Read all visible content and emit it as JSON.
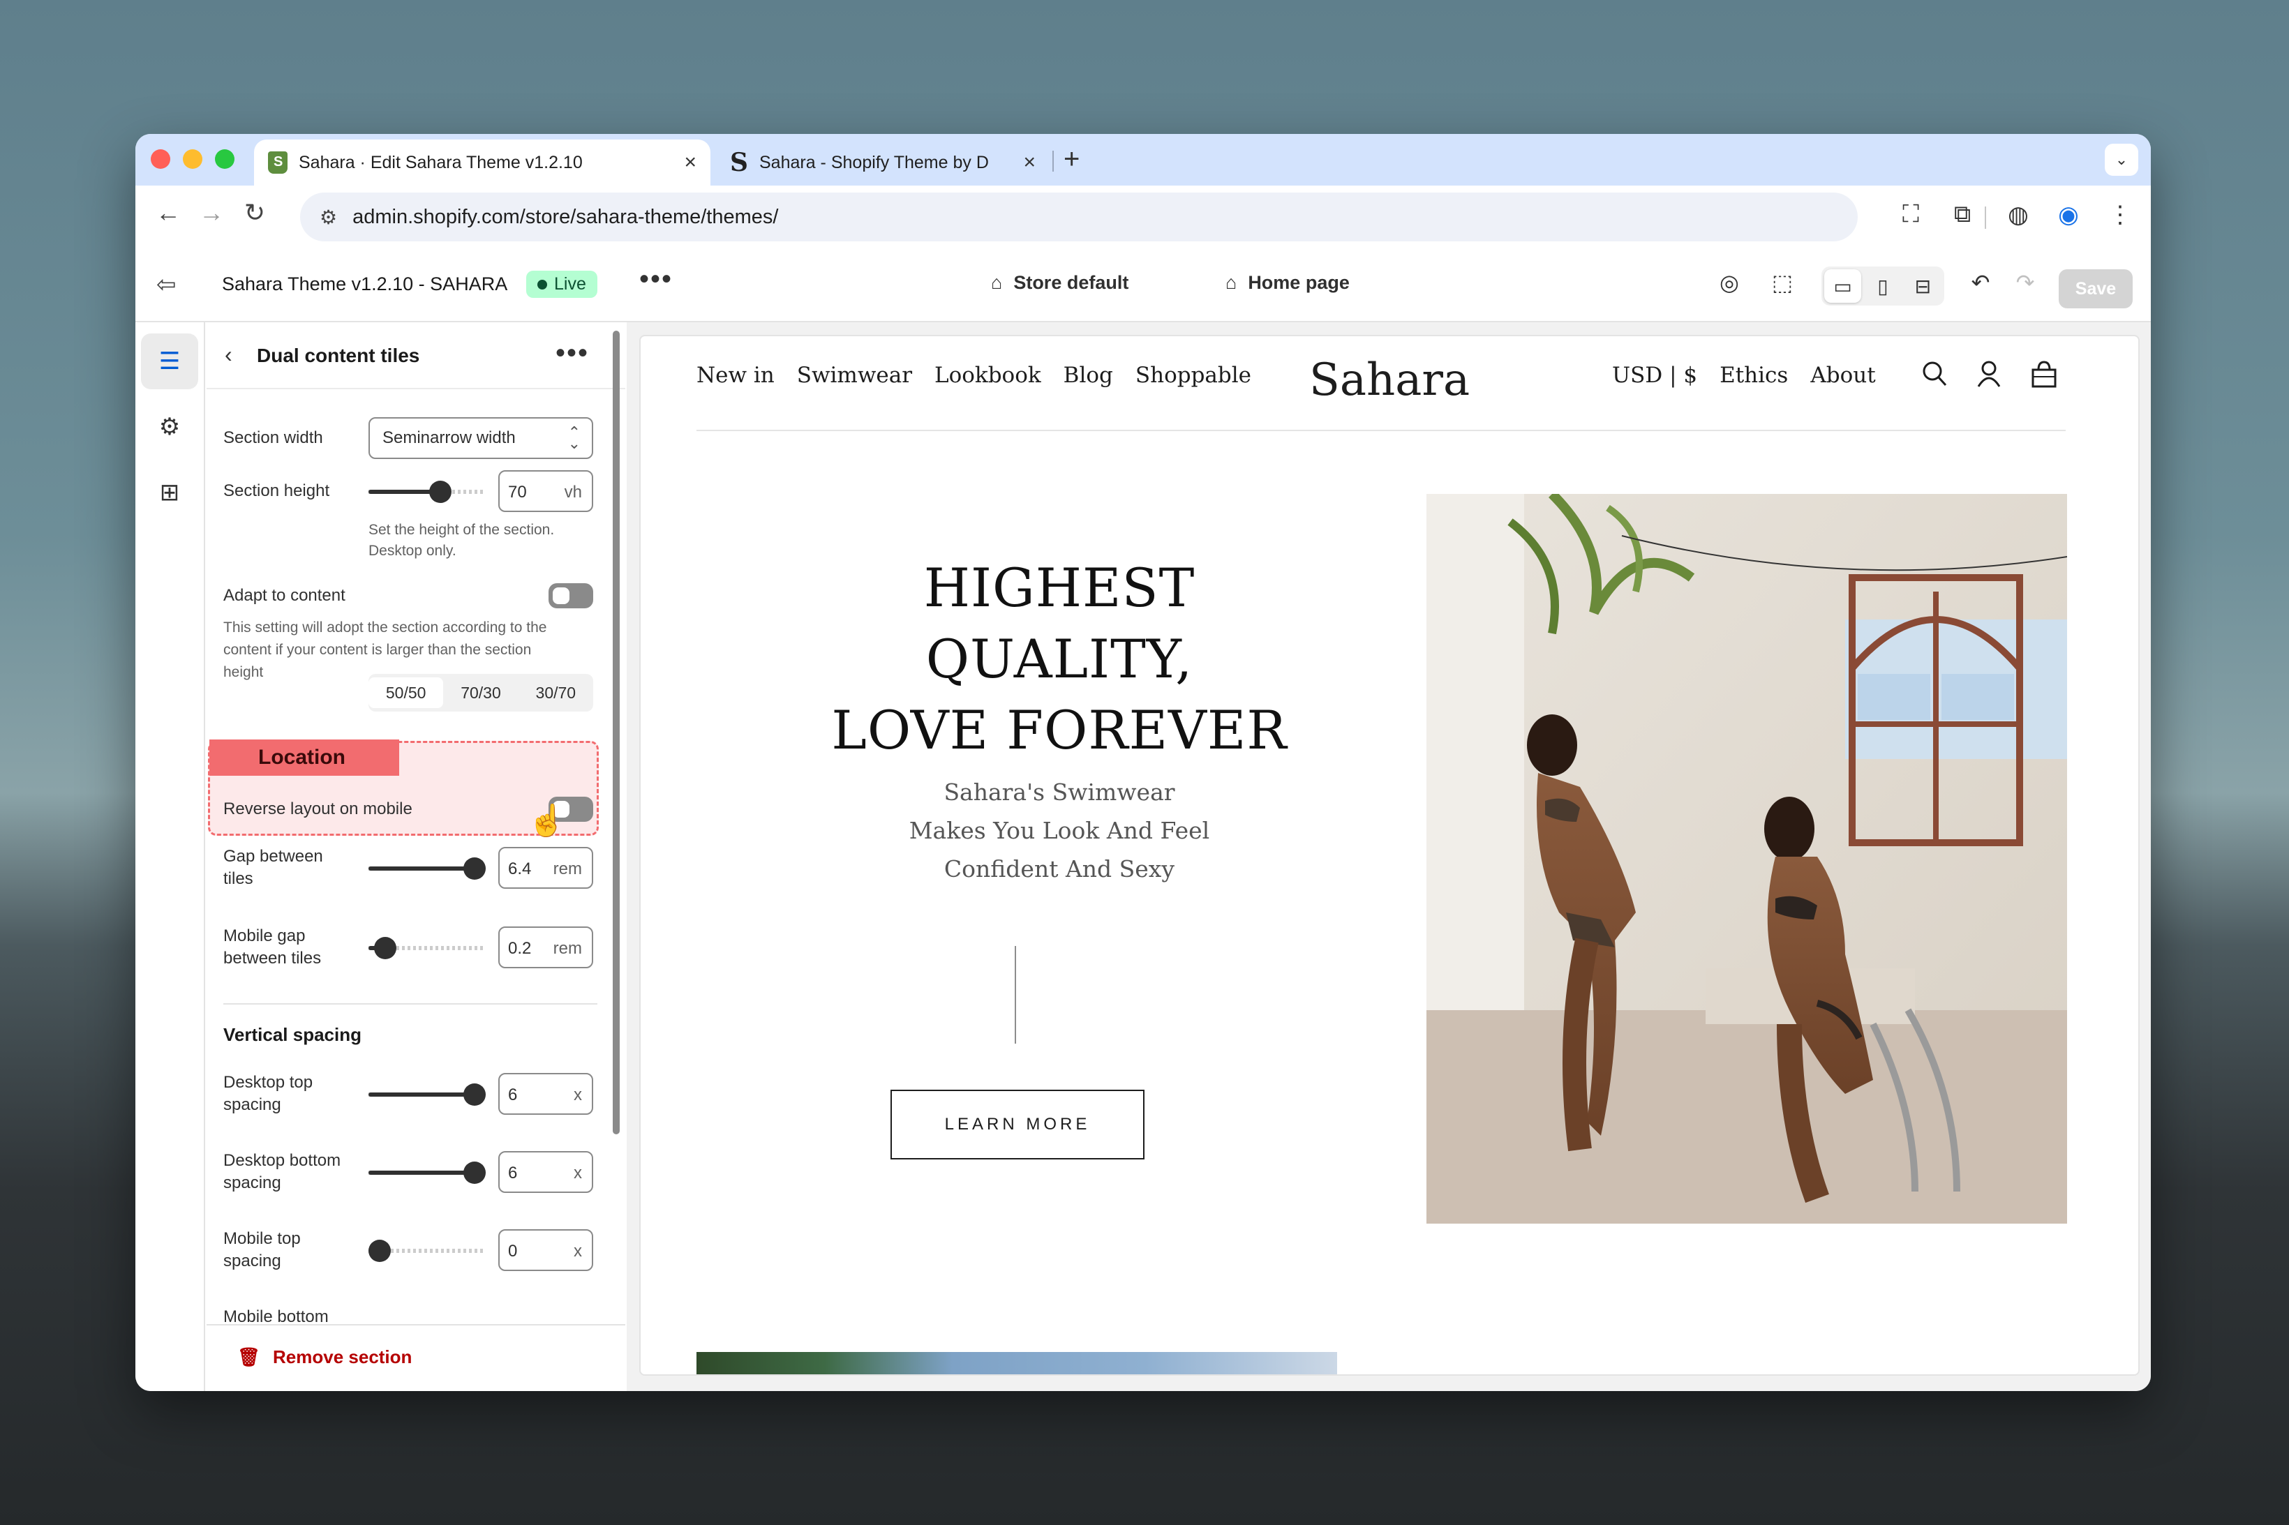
{
  "browser": {
    "tabs": [
      {
        "title": "Sahara · Edit Sahara Theme v1.2.10",
        "close": "×"
      },
      {
        "title": "Sahara - Shopify Theme by D",
        "close": "×"
      }
    ],
    "new_tab": "+",
    "url": "admin.shopify.com/store/sahara-theme/themes/"
  },
  "editor": {
    "theme_name": "Sahara Theme v1.2.10 - SAHARA",
    "live_badge": "Live",
    "store_default": "Store default",
    "home_page": "Home page",
    "save_label": "Save"
  },
  "panel": {
    "title": "Dual content tiles",
    "section_width_label": "Section width",
    "section_width_value": "Seminarrow width",
    "section_height_label": "Section height",
    "section_height_value": "70",
    "section_height_unit": "vh",
    "section_height_level": 0.64,
    "section_height_help_1": "Set the height of the section.",
    "section_height_help_2": "Desktop only.",
    "adapt_label": "Adapt to content",
    "adapt_help_1": "This setting will adopt the section according to the",
    "adapt_help_2": "content if your content is larger than the section",
    "adapt_help_3": "height",
    "layout_options": [
      "50/50",
      "70/30",
      "30/70"
    ],
    "location_tag": "Location",
    "reverse_label": "Reverse layout on mobile",
    "gap_label_1": "Gap between",
    "gap_label_2": "tiles",
    "gap_value": "6.4",
    "gap_unit": "rem",
    "gap_level": 1.0,
    "mgap_label_1": "Mobile gap",
    "mgap_label_2": "between tiles",
    "mgap_value": "0.2",
    "mgap_unit": "rem",
    "mgap_level": 0.06,
    "vertical_spacing": "Vertical spacing",
    "dtop_label_1": "Desktop top",
    "dtop_label_2": "spacing",
    "dtop_value": "6",
    "dtop_unit": "x",
    "dtop_level": 1.0,
    "dbottom_label_1": "Desktop bottom",
    "dbottom_label_2": "spacing",
    "dbottom_value": "6",
    "dbottom_unit": "x",
    "dbottom_level": 1.0,
    "mtop_label_1": "Mobile top",
    "mtop_label_2": "spacing",
    "mtop_value": "0",
    "mtop_unit": "x",
    "mtop_level": 0.0,
    "mbottom_label": "Mobile bottom",
    "remove_label": "Remove section"
  },
  "store": {
    "nav": [
      "New in",
      "Swimwear",
      "Lookbook",
      "Blog",
      "Shoppable"
    ],
    "logo": "Sahara",
    "currency": "USD | $",
    "right_links": [
      "Ethics",
      "About"
    ],
    "hero_heading_1": "HIGHEST",
    "hero_heading_2": "QUALITY,",
    "hero_heading_3": "LOVE FOREVER",
    "hero_sub_1": "Sahara's Swimwear",
    "hero_sub_2": "Makes You Look And Feel",
    "hero_sub_3": "Confident And Sexy",
    "cta": "LEARN MORE"
  },
  "icons": {
    "back": "back-arrow-icon",
    "forward": "forward-arrow-icon",
    "reload": "reload-icon",
    "exit": "exit-icon",
    "sections": "sections-icon",
    "settings": "gear-icon",
    "apps": "apps-icon",
    "search": "search-icon",
    "account": "account-icon",
    "bag": "bag-icon",
    "trash": "trash-icon"
  },
  "colors": {
    "live_bg": "#b4fed2",
    "live_text": "#0c5132",
    "location_accent": "#f26c6f",
    "remove_text": "#b50000"
  }
}
